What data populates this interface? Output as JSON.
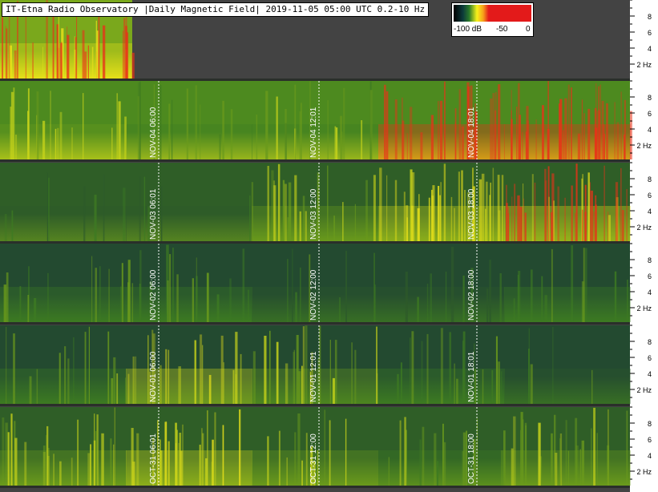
{
  "title": "IT-Etna Radio Observatory |Daily Magnetic Field| 2019-11-05 05:00 UTC 0.2-10 Hz",
  "color_scale": {
    "labels": [
      "-100 dB",
      "-50",
      "0"
    ],
    "stops": [
      "#000000",
      "#0d3b3b",
      "#2a7a2a",
      "#f7f21a",
      "#f7a01a",
      "#e31a1a"
    ]
  },
  "freq_tick_labels": [
    "8",
    "6",
    "4",
    "2 Hz"
  ],
  "chart_data": {
    "type": "heatmap",
    "title": "IT-Etna Radio Observatory |Daily Magnetic Field| 2019-11-05 05:00 UTC 0.2-10 Hz",
    "xlabel": "",
    "ylabel": "",
    "colorbar": {
      "min": -100,
      "max": 0,
      "unit": "dB",
      "ticks": [
        -100,
        -50,
        0
      ]
    },
    "y_ticks": [
      8,
      6,
      4,
      2
    ],
    "y_range": [
      0.2,
      10
    ],
    "rows": [
      {
        "day": "2019-11-05",
        "markers": [],
        "activity": [
          0.85,
          0.85,
          0.85,
          0.85,
          0.85
        ],
        "strip_fraction": 0.21
      },
      {
        "day": "2019-11-04",
        "markers": [
          "NOV-04 06:00",
          "NOV-04 12:01",
          "NOV-04 18:01"
        ],
        "activity": [
          0.45,
          0.25,
          0.3,
          0.95,
          0.97
        ]
      },
      {
        "day": "2019-11-03",
        "markers": [
          "NOV-03 06:01",
          "NOV-03 12:00",
          "NOV-03 18:00"
        ],
        "activity": [
          0.15,
          0.12,
          0.4,
          0.65,
          0.85
        ]
      },
      {
        "day": "2019-11-02",
        "markers": [
          "NOV-02 06:00",
          "NOV-02 12:00",
          "NOV-02 18:00"
        ],
        "activity": [
          0.25,
          0.22,
          0.18,
          0.15,
          0.2
        ]
      },
      {
        "day": "2019-11-01",
        "markers": [
          "NOV-01 06:00",
          "NOV-01 12:01",
          "NOV-01 18:01"
        ],
        "activity": [
          0.3,
          0.55,
          0.4,
          0.2,
          0.15
        ]
      },
      {
        "day": "2019-10-31",
        "markers": [
          "OCT-31 06:01",
          "OCT-31 12:00",
          "OCT-31 18:00"
        ],
        "activity": [
          0.45,
          0.55,
          0.4,
          0.3,
          0.35
        ]
      }
    ]
  }
}
